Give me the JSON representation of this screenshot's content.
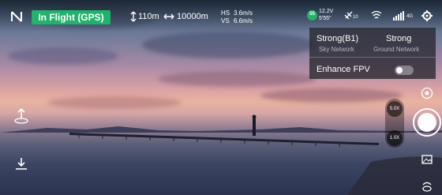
{
  "status": {
    "flight_state": "In Flight (GPS)",
    "height": "110m",
    "distance": "10000m",
    "hs_label": "HS",
    "hs_value": "3.6m/s",
    "vs_label": "VS",
    "vs_value": "6.6m/s",
    "battery_voltage": "12.2V",
    "battery_time": "5'55\"",
    "battery_percent": "55",
    "satellites": "10",
    "network_label": "4G"
  },
  "network_popup": {
    "sky": {
      "strength": "Strong(B1)",
      "label": "Sky Network"
    },
    "ground": {
      "strength": "Strong",
      "label": "Ground Network"
    },
    "enhance_fpv_label": "Enhance FPV",
    "enhance_fpv_on": false
  },
  "camera": {
    "zoom_high": "5.0X",
    "zoom_low": "1.0X"
  },
  "colors": {
    "status_green": "#1fb36b",
    "popup_bg": "rgba(40,40,48,0.78)"
  },
  "icons": [
    "map-toggle-icon",
    "height-icon",
    "distance-icon",
    "battery-icon",
    "gps-icon",
    "wifi-icon",
    "signal-icon",
    "settings-icon",
    "takeoff-icon",
    "landing-icon",
    "camera-mode-icon",
    "gallery-icon",
    "gimbal-icon"
  ]
}
